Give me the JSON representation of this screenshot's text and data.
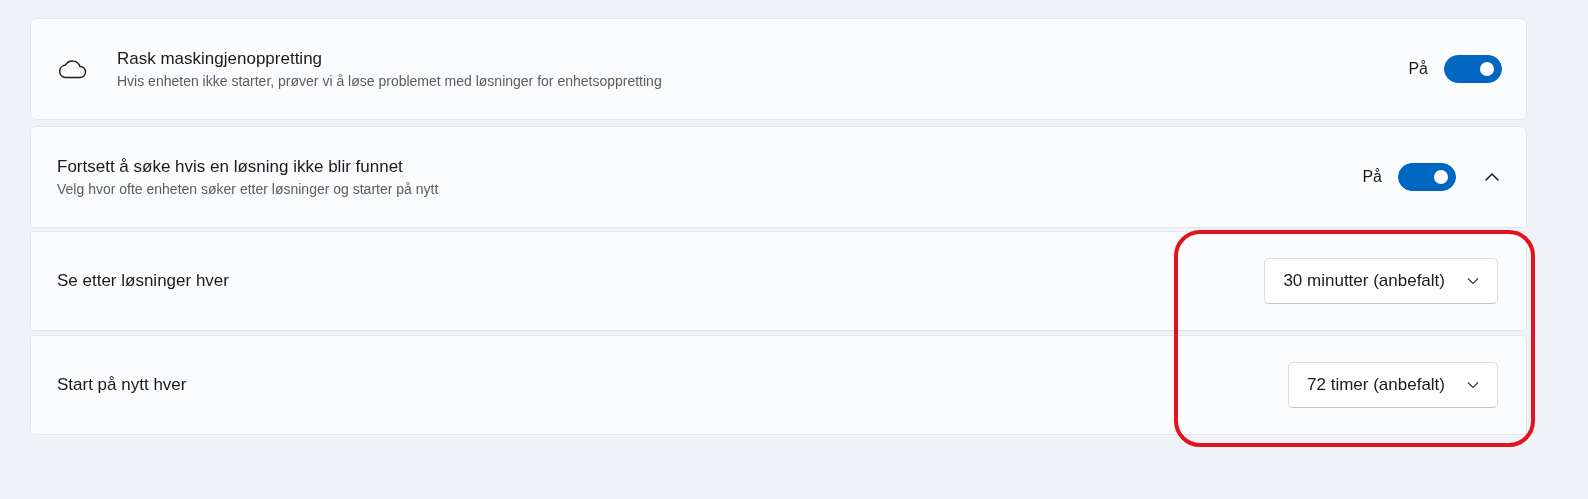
{
  "settings": [
    {
      "title": "Rask maskingjenoppretting",
      "description": "Hvis enheten ikke starter, prøver vi å løse problemet med løsninger for enhetsoppretting",
      "toggle_label": "På",
      "on": true
    },
    {
      "title": "Fortsett å søke hvis en løsning ikke blir funnet",
      "description": "Velg hvor ofte enheten søker etter løsninger og starter på nytt",
      "toggle_label": "På",
      "on": true,
      "expanded": true,
      "children": [
        {
          "label": "Se etter løsninger hver",
          "value": "30 minutter (anbefalt)"
        },
        {
          "label": "Start på nytt hver",
          "value": "72 timer (anbefalt)"
        }
      ]
    }
  ]
}
